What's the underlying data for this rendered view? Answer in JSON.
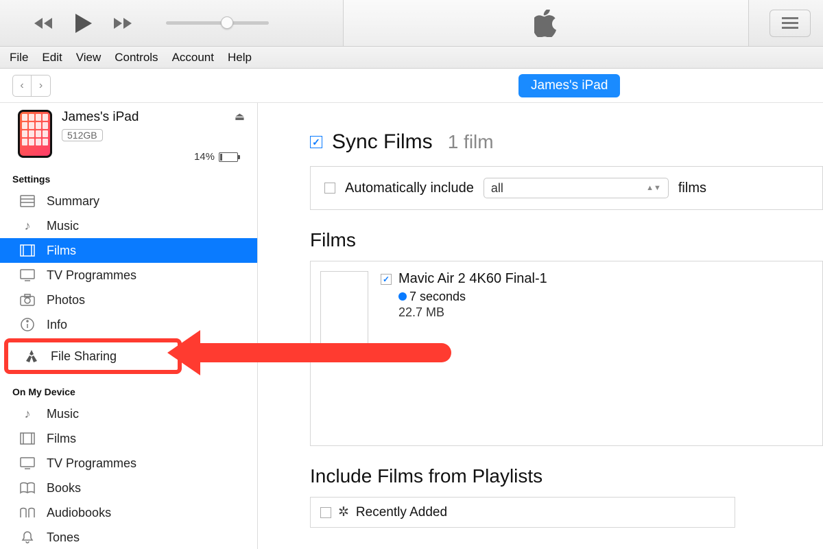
{
  "menu": {
    "file": "File",
    "edit": "Edit",
    "view": "View",
    "controls": "Controls",
    "account": "Account",
    "help": "Help"
  },
  "device_button": "James's iPad",
  "device": {
    "name": "James's iPad",
    "capacity": "512GB",
    "battery_pct": "14%"
  },
  "sidebar": {
    "settings_hdr": "Settings",
    "settings": [
      {
        "label": "Summary",
        "icon": "summary"
      },
      {
        "label": "Music",
        "icon": "music"
      },
      {
        "label": "Films",
        "icon": "films",
        "selected": true
      },
      {
        "label": "TV Programmes",
        "icon": "tv"
      },
      {
        "label": "Photos",
        "icon": "photos"
      },
      {
        "label": "Info",
        "icon": "info"
      },
      {
        "label": "File Sharing",
        "icon": "apps",
        "highlighted": true
      }
    ],
    "ondevice_hdr": "On My Device",
    "ondevice": [
      {
        "label": "Music",
        "icon": "music"
      },
      {
        "label": "Films",
        "icon": "films"
      },
      {
        "label": "TV Programmes",
        "icon": "tv"
      },
      {
        "label": "Books",
        "icon": "books"
      },
      {
        "label": "Audiobooks",
        "icon": "audiobooks"
      },
      {
        "label": "Tones",
        "icon": "tones"
      }
    ]
  },
  "content": {
    "sync_label": "Sync Films",
    "sync_checked": true,
    "count_text": "1 film",
    "auto_include_label": "Automatically include",
    "auto_include_checked": false,
    "auto_include_value": "all",
    "auto_include_suffix": "films",
    "films_hdr": "Films",
    "film": {
      "checked": true,
      "title": "Mavic Air 2 4K60 Final-1",
      "duration": "7 seconds",
      "size": "22.7 MB"
    },
    "playlists_hdr": "Include Films from Playlists",
    "playlist": {
      "checked": false,
      "name": "Recently Added"
    }
  }
}
